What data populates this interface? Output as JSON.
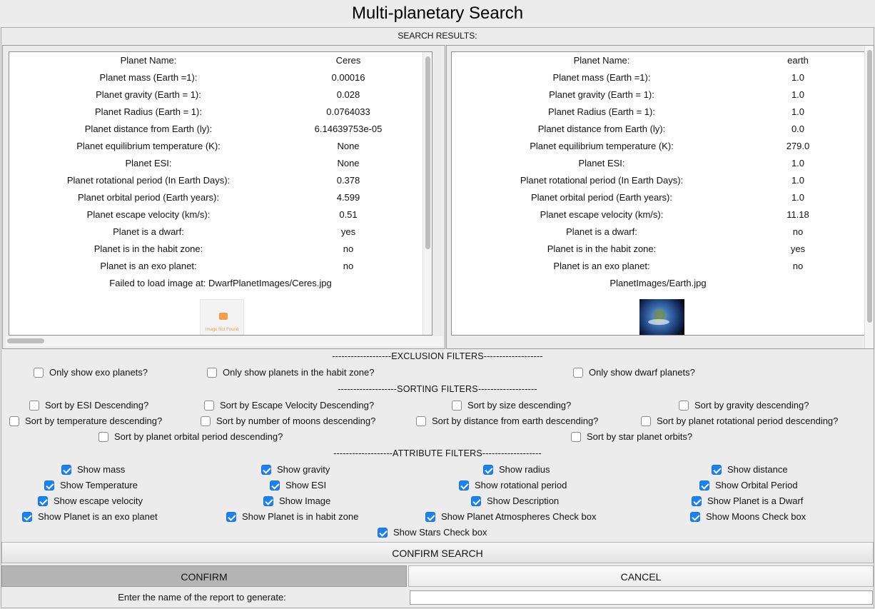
{
  "window_title": "Multi-planetary Search",
  "results_label": "SEARCH RESULTS:",
  "field_labels": [
    "Planet Name:",
    "Planet mass (Earth =1):",
    "Planet gravity (Earth = 1):",
    "Planet Radius (Earth = 1):",
    "Planet distance from Earth (ly):",
    "Planet equilibrium temperature (K):",
    "Planet ESI:",
    "Planet rotational period (In Earth Days):",
    "Planet orbital period (Earth years):",
    "Planet escape velocity (km/s):",
    "Planet is a dwarf:",
    "Planet is in the habit zone:",
    "Planet is an exo planet:"
  ],
  "planets": [
    {
      "values": [
        "Ceres",
        "0.00016",
        "0.028",
        "0.0764033",
        "6.14639753e-05",
        "None",
        "None",
        "0.378",
        "4.599",
        "0.51",
        "yes",
        "no",
        "no"
      ],
      "image_caption": "Failed to load image at: DwarfPlanetImages/Ceres.jpg",
      "image_placeholder_text": "Image Not Found"
    },
    {
      "values": [
        "earth",
        "1.0",
        "1.0",
        "1.0",
        "0.0",
        "279.0",
        "1.0",
        "1.0",
        "1.0",
        "11.18",
        "no",
        "yes",
        "no"
      ],
      "image_caption": "PlanetImages/Earth.jpg"
    }
  ],
  "exclusion": {
    "header": "-------------------EXCLUSION FILTERS-------------------",
    "items": [
      {
        "label": "Only show exo planets?",
        "checked": false
      },
      {
        "label": "Only show planets in the habit zone?",
        "checked": false
      },
      {
        "label": "Only show dwarf planets?",
        "checked": false
      }
    ]
  },
  "sorting": {
    "header": "-------------------SORTING FILTERS-------------------",
    "items": [
      {
        "label": "Sort by ESI Descending?",
        "checked": false
      },
      {
        "label": "Sort by Escape Velocity Descending?",
        "checked": false
      },
      {
        "label": "Sort by size descending?",
        "checked": false
      },
      {
        "label": "Sort by gravity descending?",
        "checked": false
      },
      {
        "label": "Sort by temperature descending?",
        "checked": false
      },
      {
        "label": "Sort by number of moons descending?",
        "checked": false
      },
      {
        "label": "Sort by distance from earth descending?",
        "checked": false
      },
      {
        "label": "Sort by planet rotational period descending?",
        "checked": false
      },
      {
        "label": "Sort by planet orbital period descending?",
        "checked": false
      },
      {
        "label": "Sort by star planet orbits?",
        "checked": false
      }
    ]
  },
  "attribute": {
    "header": "-------------------ATTRIBUTE FILTERS-------------------",
    "items": [
      {
        "label": "Show mass",
        "checked": true
      },
      {
        "label": "Show gravity",
        "checked": true
      },
      {
        "label": "Show radius",
        "checked": true
      },
      {
        "label": "Show distance",
        "checked": true
      },
      {
        "label": "Show Temperature",
        "checked": true
      },
      {
        "label": "Show ESI",
        "checked": true
      },
      {
        "label": "Show rotational period",
        "checked": true
      },
      {
        "label": "Show Orbital Period",
        "checked": true
      },
      {
        "label": "Show escape velocity",
        "checked": true
      },
      {
        "label": "Show Image",
        "checked": true
      },
      {
        "label": "Show Description",
        "checked": true
      },
      {
        "label": "Show Planet is a Dwarf",
        "checked": true
      },
      {
        "label": "Show Planet is an exo planet",
        "checked": true
      },
      {
        "label": "Show Planet is in habit zone",
        "checked": true
      },
      {
        "label": "Show Planet Atmospheres Check box",
        "checked": true
      },
      {
        "label": "Show Moons Check box",
        "checked": true
      },
      {
        "label": "Show Stars Check box",
        "checked": true
      }
    ]
  },
  "buttons": {
    "confirm_search": "CONFIRM SEARCH",
    "confirm": "CONFIRM",
    "cancel": "CANCEL"
  },
  "report": {
    "label": "Enter the name of the report to generate:",
    "value": ""
  },
  "colors": {
    "checkbox_checked": "#1a82f7",
    "confirm_pressed": "#b4b4b4"
  }
}
